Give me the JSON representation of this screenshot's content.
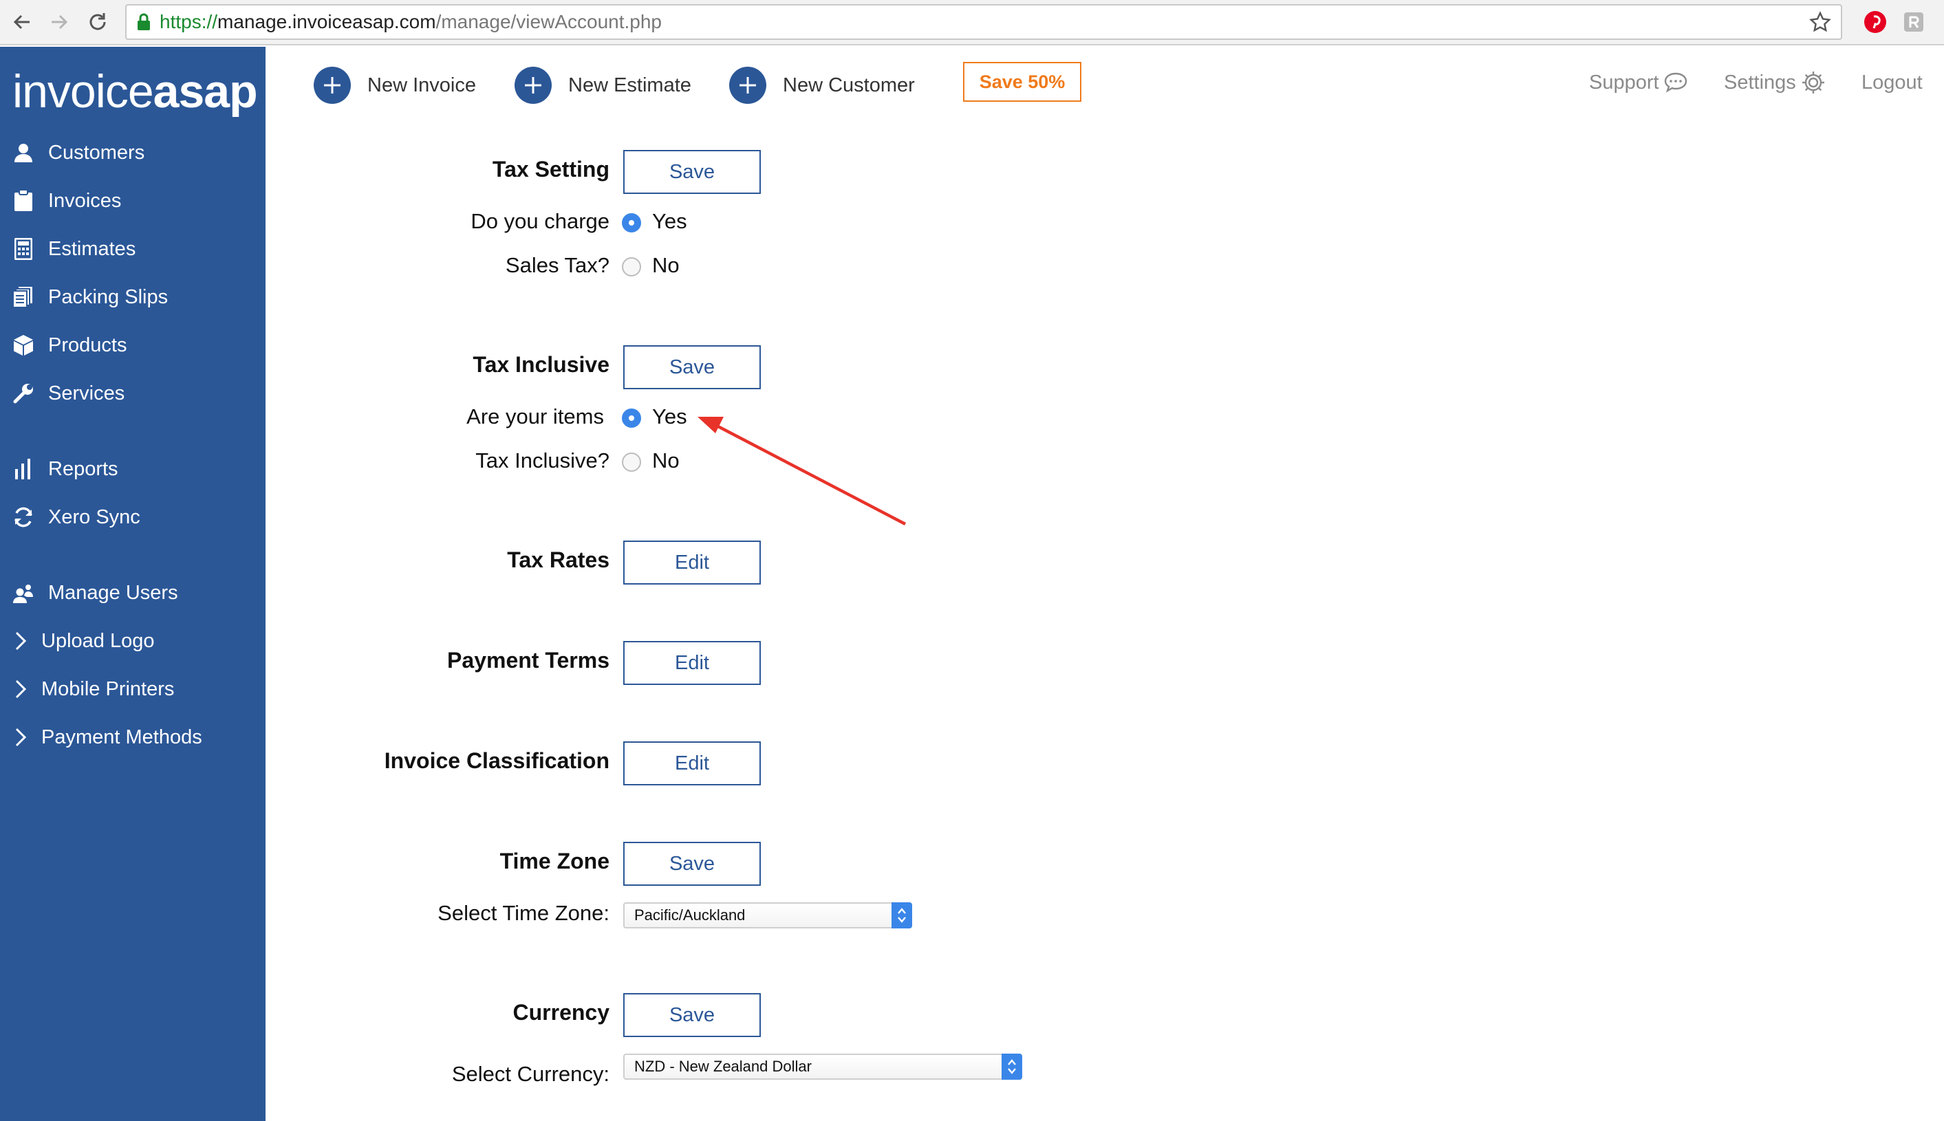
{
  "browser": {
    "url_scheme": "https://",
    "url_host": "manage.invoiceasap.com",
    "url_path": "/manage/viewAccount.php"
  },
  "brand": {
    "logo_left": "invoice",
    "logo_right": "asap"
  },
  "sidebar": {
    "items": [
      {
        "label": "Customers",
        "icon": "user-icon"
      },
      {
        "label": "Invoices",
        "icon": "clipboard-icon"
      },
      {
        "label": "Estimates",
        "icon": "calculator-icon"
      },
      {
        "label": "Packing Slips",
        "icon": "packing-slips-icon"
      },
      {
        "label": "Products",
        "icon": "box-icon"
      },
      {
        "label": "Services",
        "icon": "wrench-icon"
      },
      {
        "label": "Reports",
        "icon": "bar-chart-icon"
      },
      {
        "label": "Xero Sync",
        "icon": "sync-icon"
      },
      {
        "label": "Manage Users",
        "icon": "users-icon"
      },
      {
        "label": "Upload Logo",
        "icon": "chevron-right-icon"
      },
      {
        "label": "Mobile Printers",
        "icon": "chevron-right-icon"
      },
      {
        "label": "Payment Methods",
        "icon": "chevron-right-icon"
      }
    ]
  },
  "toolbar": {
    "new_invoice": "New Invoice",
    "new_estimate": "New Estimate",
    "new_customer": "New Customer",
    "promo": "Save 50%",
    "support": "Support",
    "settings": "Settings",
    "logout": "Logout"
  },
  "settings": {
    "tax_setting": {
      "title": "Tax Setting",
      "button": "Save",
      "question_line1": "Do you charge",
      "question_line2": "Sales Tax?",
      "yes": "Yes",
      "no": "No",
      "selected": "Yes"
    },
    "tax_inclusive": {
      "title": "Tax Inclusive",
      "button": "Save",
      "question_line1": "Are your items",
      "question_line2": "Tax Inclusive?",
      "yes": "Yes",
      "no": "No",
      "selected": "Yes"
    },
    "tax_rates": {
      "title": "Tax Rates",
      "button": "Edit"
    },
    "payment_terms": {
      "title": "Payment Terms",
      "button": "Edit"
    },
    "invoice_classification": {
      "title": "Invoice Classification",
      "button": "Edit"
    },
    "time_zone": {
      "title": "Time Zone",
      "button": "Save",
      "label": "Select Time Zone:",
      "value": "Pacific/Auckland"
    },
    "currency": {
      "title": "Currency",
      "button": "Save",
      "label": "Select Currency:",
      "value": "NZD - New Zealand Dollar"
    }
  },
  "colors": {
    "sidebar_bg": "#2b5797",
    "accent": "#2b5797",
    "promo": "#f07a1a",
    "radio_checked": "#3a86e8",
    "annotation_arrow": "#e8332a"
  }
}
